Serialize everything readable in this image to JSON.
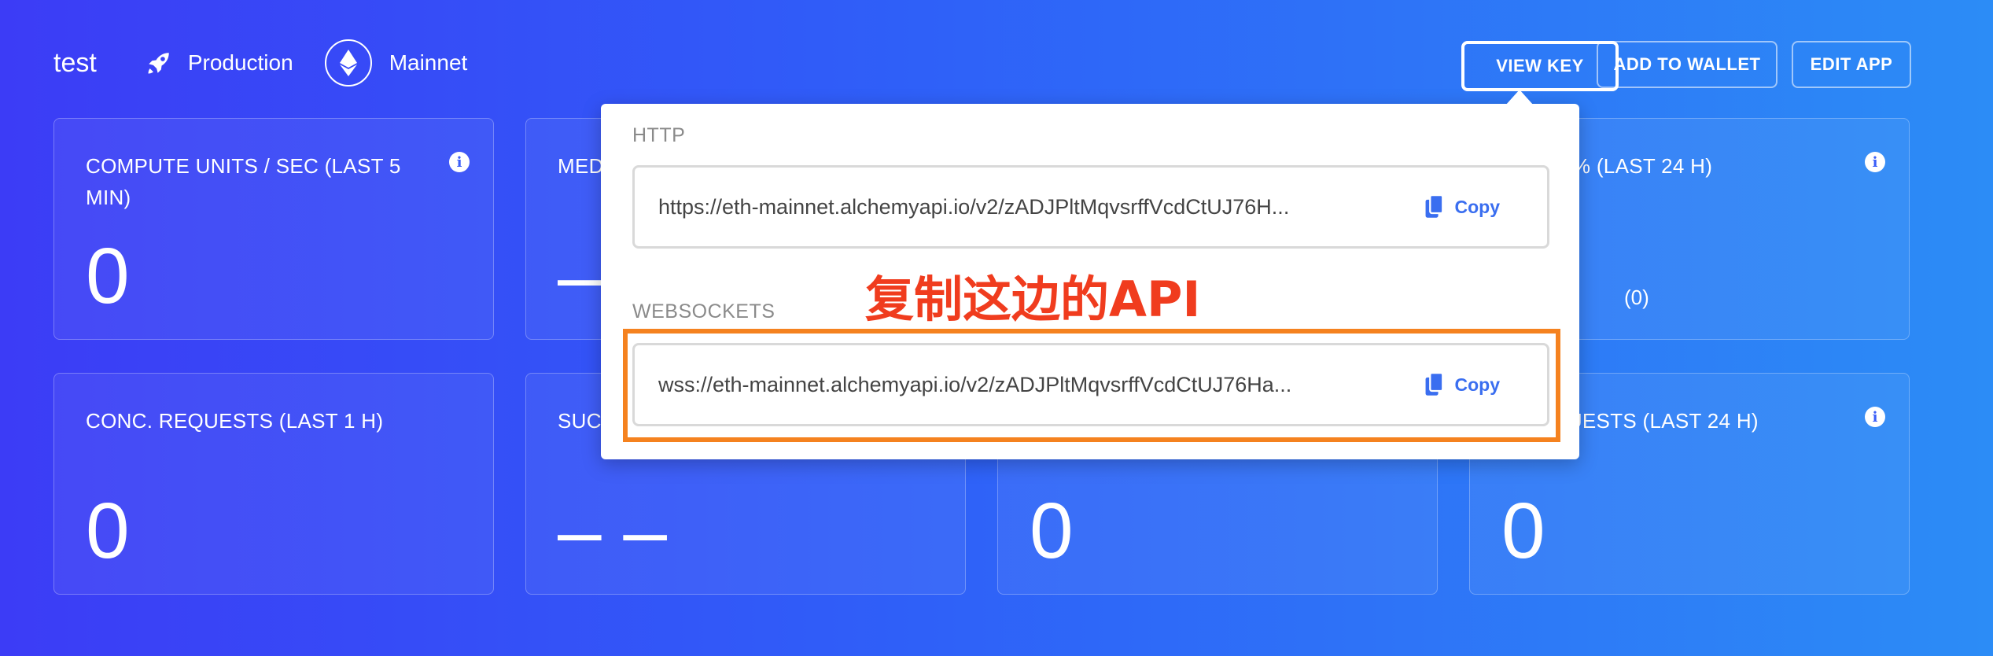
{
  "header": {
    "app_name": "test",
    "environment": "Production",
    "network": "Mainnet",
    "buttons": {
      "view_key": "VIEW KEY",
      "add_to_wallet": "ADD TO WALLET",
      "edit_app": "EDIT APP"
    }
  },
  "cards_row1": [
    {
      "label": "COMPUTE UNITS / SEC (LAST 5 MIN)",
      "value": "0"
    },
    {
      "label": "MED",
      "value": "–"
    },
    {
      "label": "",
      "value": ""
    },
    {
      "label": "MITED % (LAST 24 H)",
      "value": "%",
      "sub": "(0)"
    }
  ],
  "cards_row2": [
    {
      "label": "CONC. REQUESTS (LAST 1 H)",
      "value": "0"
    },
    {
      "label": "SUC",
      "value": "– –"
    },
    {
      "label": "",
      "value": "0"
    },
    {
      "label": "D REQUESTS (LAST 24 H)",
      "value": "0"
    }
  ],
  "popover": {
    "http_label": "HTTP",
    "http_url": "https://eth-mainnet.alchemyapi.io/v2/zADJPltMqvsrffVcdCtUJ76H...",
    "ws_label": "WEBSOCKETS",
    "ws_url": "wss://eth-mainnet.alchemyapi.io/v2/zADJPltMqvsrffVcdCtUJ76Ha...",
    "copy_label": "Copy"
  },
  "annotation": {
    "text": "复制这边的API",
    "color": "#f03c1e",
    "box_color": "#f5821f"
  }
}
